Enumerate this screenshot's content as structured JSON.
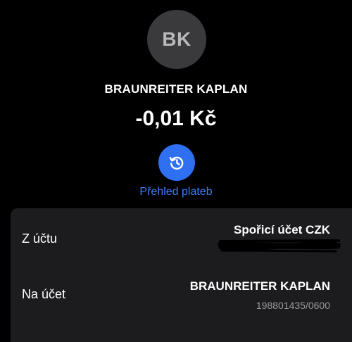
{
  "avatar": {
    "initials": "BK"
  },
  "payee": {
    "name": "BRAUNREITER KAPLAN"
  },
  "amount": "-0,01 Kč",
  "history": {
    "label": "Přehled plateb",
    "icon": "history-icon"
  },
  "details": {
    "from": {
      "label": "Z účtu",
      "value": "Spořicí účet CZK"
    },
    "to": {
      "label": "Na účet",
      "value": "BRAUNREITER KAPLAN",
      "account": "198801435/0600"
    }
  },
  "colors": {
    "background": "#000000",
    "card": "#1c1c1e",
    "accent": "#2f6ff2",
    "link": "#3d7ef7",
    "muted": "#9b9ba0"
  }
}
